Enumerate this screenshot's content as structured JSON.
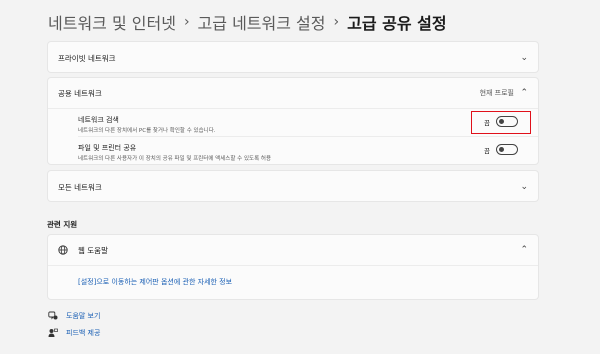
{
  "breadcrumb": {
    "item1": "네트워크 및 인터넷",
    "item2": "고급 네트워크 설정",
    "current": "고급 공유 설정",
    "separator": "›"
  },
  "private_network": {
    "title": "프라이빗 네트워크"
  },
  "public_network": {
    "title": "공용 네트워크",
    "profile_label": "현재 프로필",
    "discovery": {
      "title": "네트워크 검색",
      "description": "네트워크의 다른 장치에서 PC를 찾거나 확인할 수 있습니다.",
      "state_label": "끔",
      "value": false
    },
    "file_sharing": {
      "title": "파일 및 프린터 공유",
      "description": "네트워크의 다른 사용자가 이 장치의 공유 파일 및 프린터에 액세스할 수 있도록 허용",
      "state_label": "끔",
      "value": false
    }
  },
  "all_networks": {
    "title": "모든 네트워크"
  },
  "related_support": {
    "heading": "관련 지원",
    "web_help_title": "웹 도움말",
    "link_text": "[설정]으로 이동하는 제어판 옵션에 관한 자세한 정보"
  },
  "footer": {
    "get_help": "도움말 보기",
    "give_feedback": "피드백 제공"
  },
  "colors": {
    "background": "#f3f3f3",
    "card": "#fbfbfb",
    "link": "#1a5fb4",
    "highlight": "#e0101a"
  }
}
